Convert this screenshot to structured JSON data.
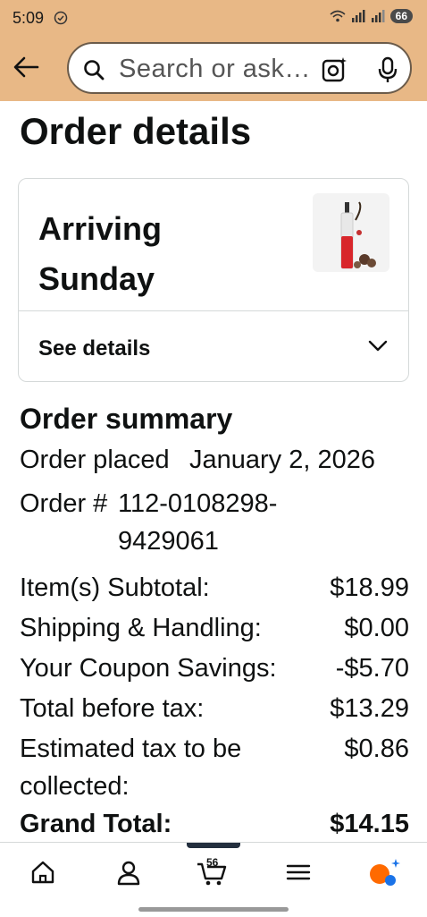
{
  "status_bar": {
    "time": "5:09",
    "battery": "66"
  },
  "header": {
    "search_placeholder": "Search or ask…"
  },
  "page": {
    "title": "Order details"
  },
  "shipment": {
    "status": "Arriving Sunday",
    "see_details_label": "See details"
  },
  "order_summary": {
    "title": "Order summary",
    "placed_label": "Order placed",
    "placed_date": "January 2, 2026",
    "order_number_label": "Order #",
    "order_number": "112-0108298-9429061",
    "lines": [
      {
        "label": "Item(s) Subtotal:",
        "amount": "$18.99"
      },
      {
        "label": "Shipping & Handling:",
        "amount": "$0.00"
      },
      {
        "label": "Your Coupon Savings:",
        "amount": "-$5.70"
      },
      {
        "label": "Total before tax:",
        "amount": "$13.29"
      },
      {
        "label": "Estimated tax to be collected:",
        "amount": "$0.86"
      },
      {
        "label": "Grand Total:",
        "amount": "$14.15"
      }
    ]
  },
  "bottom_nav": {
    "cart_count": "56"
  },
  "colors": {
    "header_bg": "#e8b886",
    "text": "#0f1111",
    "border": "#d5d9d9",
    "nav_active": "#232f3e"
  }
}
